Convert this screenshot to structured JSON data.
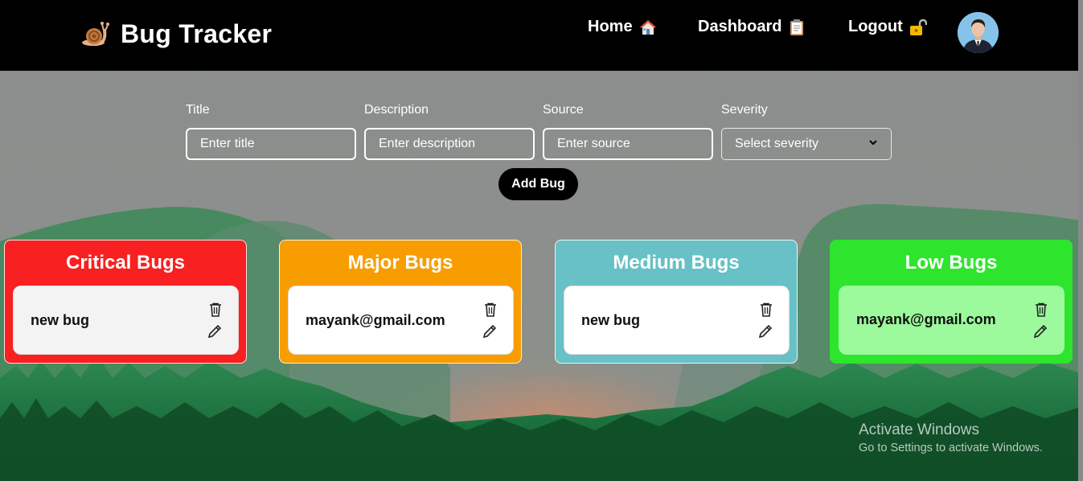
{
  "navbar": {
    "brand": "Bug Tracker",
    "brand_icon": "snail-icon",
    "links": [
      {
        "label": "Home",
        "icon": "house-icon"
      },
      {
        "label": "Dashboard",
        "icon": "clipboard-icon"
      },
      {
        "label": "Logout",
        "icon": "unlocked-padlock-icon"
      }
    ],
    "avatar_icon": "user-avatar"
  },
  "form": {
    "title": {
      "label": "Title",
      "placeholder": "Enter title"
    },
    "description": {
      "label": "Description",
      "placeholder": "Enter description"
    },
    "source": {
      "label": "Source",
      "placeholder": "Enter source"
    },
    "severity": {
      "label": "Severity",
      "selected": "Select severity"
    },
    "submit_label": "Add Bug"
  },
  "columns": [
    {
      "title": "Critical Bugs",
      "color": "#f82020",
      "bugs": [
        {
          "title": "new bug"
        }
      ]
    },
    {
      "title": "Major Bugs",
      "color": "#f89d00",
      "bugs": [
        {
          "title": "mayank@gmail.com"
        }
      ]
    },
    {
      "title": "Medium Bugs",
      "color": "#67c1c6",
      "bugs": [
        {
          "title": "new bug"
        }
      ]
    },
    {
      "title": "Low Bugs",
      "color": "#2ee52e",
      "bugs": [
        {
          "title": "mayank@gmail.com"
        }
      ]
    }
  ],
  "watermark": {
    "title": "Activate Windows",
    "subtitle": "Go to Settings to activate Windows."
  }
}
